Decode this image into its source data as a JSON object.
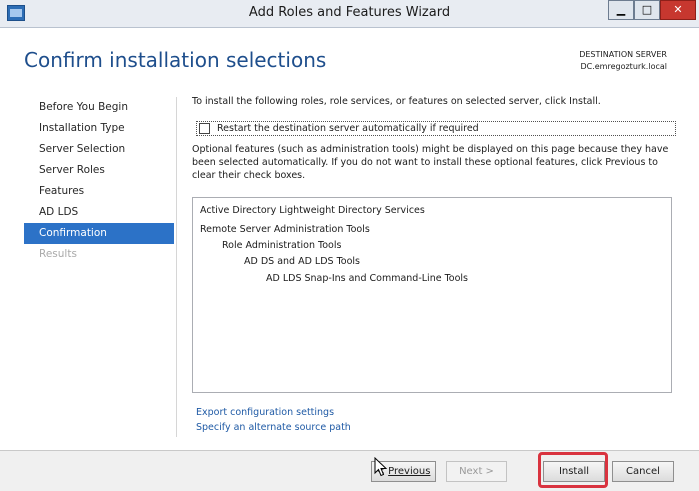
{
  "window": {
    "title": "Add Roles and Features Wizard",
    "min_glyph": "▁",
    "max_glyph": "□",
    "close_glyph": "✕"
  },
  "header": {
    "page_title": "Confirm installation selections",
    "destination_label": "DESTINATION SERVER",
    "destination_server": "DC.emregozturk.local"
  },
  "nav": {
    "items": [
      {
        "label": "Before You Begin",
        "state": "normal"
      },
      {
        "label": "Installation Type",
        "state": "normal"
      },
      {
        "label": "Server Selection",
        "state": "normal"
      },
      {
        "label": "Server Roles",
        "state": "normal"
      },
      {
        "label": "Features",
        "state": "normal"
      },
      {
        "label": "AD LDS",
        "state": "normal"
      },
      {
        "label": "Confirmation",
        "state": "active"
      },
      {
        "label": "Results",
        "state": "disabled"
      }
    ]
  },
  "content": {
    "intro": "To install the following roles, role services, or features on selected server, click Install.",
    "restart_label": "Restart the destination server automatically if required",
    "restart_checked": false,
    "optional_text": "Optional features (such as administration tools) might be displayed on this page because they have been selected automatically. If you do not want to install these optional features, click Previous to clear their check boxes.",
    "features": [
      "Active Directory Lightweight Directory Services",
      "Remote Server Administration Tools",
      "Role Administration Tools",
      "AD DS and AD LDS Tools",
      "AD LDS Snap-Ins and Command-Line Tools"
    ],
    "export_link": "Export configuration settings",
    "alt_source_link": "Specify an alternate source path"
  },
  "buttons": {
    "previous_label": "Previous",
    "next_label": "Next >",
    "install_label": "Install",
    "cancel_label": "Cancel"
  },
  "colors": {
    "accent": "#2c72c7",
    "title_blue": "#1e4e8c",
    "link": "#1f5aa5",
    "highlight": "#d9333f"
  }
}
